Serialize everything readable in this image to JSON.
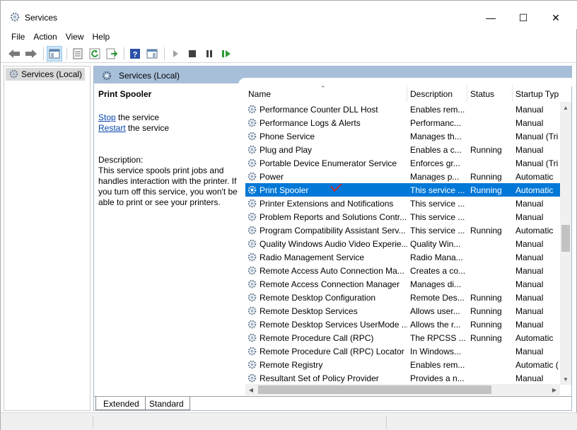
{
  "window": {
    "title": "Services",
    "minimize_glyph": "—",
    "maximize_glyph": "☐",
    "close_glyph": "✕"
  },
  "menu": [
    "File",
    "Action",
    "View",
    "Help"
  ],
  "toolbar": {
    "icons": [
      "back-arrow-icon",
      "forward-arrow-icon",
      "console-tree-icon",
      "properties-icon",
      "refresh-icon",
      "export-list-icon",
      "help-icon",
      "show-hide-action-pane-icon",
      "start-service-icon",
      "stop-service-icon",
      "pause-service-icon",
      "restart-service-icon"
    ]
  },
  "tree": {
    "root_label": "Services (Local)"
  },
  "content": {
    "header_title": "Services (Local)",
    "selected_service": "Print Spooler",
    "stop_link": "Stop",
    "stop_suffix": " the service",
    "restart_link": "Restart",
    "restart_suffix": " the service",
    "description_label": "Description:",
    "description_text": "This service spools print jobs and handles interaction with the printer. If you turn off this service, you won't be able to print or see your printers."
  },
  "columns": {
    "name": "Name",
    "description": "Description",
    "status": "Status",
    "startup": "Startup Typ"
  },
  "services": [
    {
      "name": "Performance Counter DLL Host",
      "description": "Enables rem...",
      "status": "",
      "startup": "Manual"
    },
    {
      "name": "Performance Logs & Alerts",
      "description": "Performanc...",
      "status": "",
      "startup": "Manual"
    },
    {
      "name": "Phone Service",
      "description": "Manages th...",
      "status": "",
      "startup": "Manual (Tri"
    },
    {
      "name": "Plug and Play",
      "description": "Enables a c...",
      "status": "Running",
      "startup": "Manual"
    },
    {
      "name": "Portable Device Enumerator Service",
      "description": "Enforces gr...",
      "status": "",
      "startup": "Manual (Tri"
    },
    {
      "name": "Power",
      "description": "Manages p...",
      "status": "Running",
      "startup": "Automatic"
    },
    {
      "name": "Print Spooler",
      "description": "This service ...",
      "status": "Running",
      "startup": "Automatic",
      "selected": true
    },
    {
      "name": "Printer Extensions and Notifications",
      "description": "This service ...",
      "status": "",
      "startup": "Manual"
    },
    {
      "name": "Problem Reports and Solutions Contr...",
      "description": "This service ...",
      "status": "",
      "startup": "Manual"
    },
    {
      "name": "Program Compatibility Assistant Serv...",
      "description": "This service ...",
      "status": "Running",
      "startup": "Automatic"
    },
    {
      "name": "Quality Windows Audio Video Experie...",
      "description": "Quality Win...",
      "status": "",
      "startup": "Manual"
    },
    {
      "name": "Radio Management Service",
      "description": "Radio Mana...",
      "status": "",
      "startup": "Manual"
    },
    {
      "name": "Remote Access Auto Connection Ma...",
      "description": "Creates a co...",
      "status": "",
      "startup": "Manual"
    },
    {
      "name": "Remote Access Connection Manager",
      "description": "Manages di...",
      "status": "",
      "startup": "Manual"
    },
    {
      "name": "Remote Desktop Configuration",
      "description": "Remote Des...",
      "status": "Running",
      "startup": "Manual"
    },
    {
      "name": "Remote Desktop Services",
      "description": "Allows user...",
      "status": "Running",
      "startup": "Manual"
    },
    {
      "name": "Remote Desktop Services UserMode ...",
      "description": "Allows the r...",
      "status": "Running",
      "startup": "Manual"
    },
    {
      "name": "Remote Procedure Call (RPC)",
      "description": "The RPCSS ...",
      "status": "Running",
      "startup": "Automatic"
    },
    {
      "name": "Remote Procedure Call (RPC) Locator",
      "description": "In Windows...",
      "status": "",
      "startup": "Manual"
    },
    {
      "name": "Remote Registry",
      "description": "Enables rem...",
      "status": "",
      "startup": "Automatic ("
    },
    {
      "name": "Resultant Set of Policy Provider",
      "description": "Provides a n...",
      "status": "",
      "startup": "Manual"
    }
  ],
  "tabs": [
    "Extended",
    "Standard"
  ],
  "colors": {
    "selection": "#0078d7",
    "header_band": "#a7bfd9",
    "link": "#0645ad",
    "annotation": "#e02020"
  }
}
